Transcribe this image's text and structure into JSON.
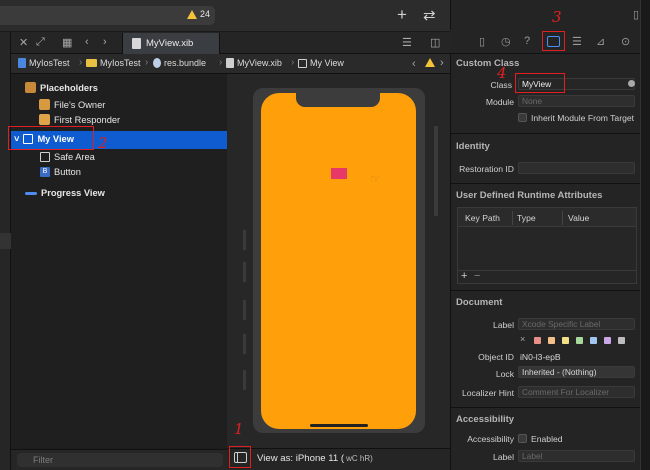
{
  "toolbar": {
    "warning_count": "24",
    "add_icon": "plus-icon",
    "layout_icon": "swap-arrows-icon"
  },
  "editor": {
    "tab_name": "MyView.xib",
    "jump_bar": [
      "MyIosTest",
      "MyIosTest",
      "res.bundle",
      "MyView.xib",
      "My View"
    ]
  },
  "outline": {
    "placeholders": "Placeholders",
    "files_owner": "File's Owner",
    "first_responder": "First Responder",
    "my_view": "My View",
    "safe_area": "Safe Area",
    "button": "Button",
    "progress_view": "Progress View",
    "filter_placeholder": "Filter"
  },
  "canvas": {
    "view_as": "View as: iPhone 11 (",
    "traits": "wC  hR)",
    "phone_color": "#ff9f0a",
    "progress_color": "#e7386a"
  },
  "inspector": {
    "custom_class": {
      "title": "Custom Class",
      "class_label": "Class",
      "class_value": "MyView",
      "module_label": "Module",
      "module_placeholder": "None",
      "inherit_label": "Inherit Module From Target"
    },
    "identity": {
      "title": "Identity",
      "restoration_label": "Restoration ID"
    },
    "runtime": {
      "title": "User Defined Runtime Attributes",
      "col_key": "Key Path",
      "col_type": "Type",
      "col_value": "Value",
      "add": "+",
      "remove": "−"
    },
    "document": {
      "title": "Document",
      "label_label": "Label",
      "label_placeholder": "Xcode Specific Label",
      "object_id_label": "Object ID",
      "object_id_value": "iN0-l3-epB",
      "lock_label": "Lock",
      "lock_value": "Inherited - (Nothing)",
      "localizer_label": "Localizer Hint",
      "localizer_placeholder": "Comment For Localizer"
    },
    "accessibility": {
      "title": "Accessibility",
      "acc_label": "Accessibility",
      "enabled_label": "Enabled",
      "label_label": "Label",
      "label_placeholder": "Label"
    }
  },
  "annotations": [
    "1",
    "2",
    "3",
    "4"
  ]
}
